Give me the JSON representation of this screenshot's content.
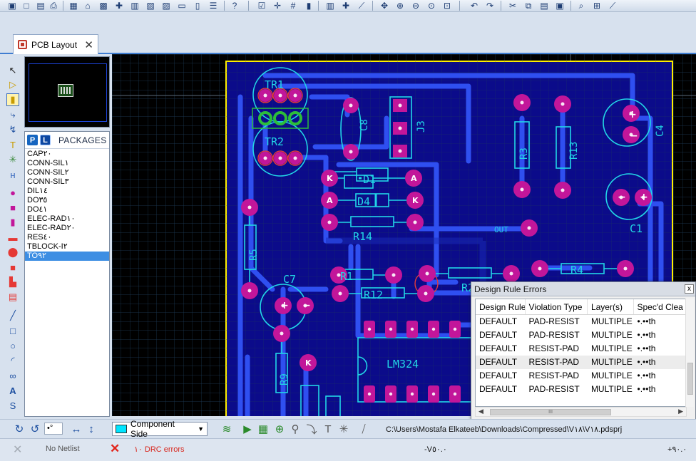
{
  "toolbar": {
    "icons": [
      "select-icon",
      "save-icon",
      "print-icon",
      "home-icon",
      "zoom-icon",
      "help-icon",
      "grid-icon",
      "component-icon",
      "junction-icon",
      "zoom-in-icon",
      "zoom-out-icon",
      "zoom-fit-icon",
      "undo-icon",
      "redo-icon",
      "search-icon"
    ]
  },
  "tab": {
    "label": "PCB Layout",
    "close": "✕"
  },
  "packages": {
    "p_label": "P",
    "l_label": "L",
    "title": "PACKAGES",
    "items": [
      "CAP٢٠",
      "CONN-SIL١",
      "CONN-SIL٢",
      "CONN-SIL٣",
      "DIL١٤",
      "DO٣٥",
      "DO٤١",
      "ELEC-RAD١٠",
      "ELEC-RAD٢٠",
      "RES٤٠",
      "TBLOCK-I٢",
      "TO٩٢"
    ],
    "selected": "TO٩٢"
  },
  "pcb": {
    "labels": [
      "TR1",
      "TR2",
      "C8",
      "J3",
      "R3",
      "R13",
      "C4",
      "D1",
      "D4",
      "R14",
      "C1",
      "OUT",
      "R5",
      "C7",
      "R1",
      "R12",
      "R4",
      "LM324",
      "R9",
      "K",
      "A",
      "K",
      "A",
      "K",
      "R2"
    ]
  },
  "drc_dialog": {
    "title": "Design Rule Errors",
    "close": "x",
    "columns": [
      "Design Rule",
      "Violation Type",
      "Layer(s)",
      "Spec'd Clea"
    ],
    "rows": [
      [
        "DEFAULT",
        "PAD-RESIST",
        "MULTIPLE",
        "•.••th"
      ],
      [
        "DEFAULT",
        "PAD-RESIST",
        "MULTIPLE",
        "•.••th"
      ],
      [
        "DEFAULT",
        "RESIST-PAD",
        "MULTIPLE",
        "•.••th"
      ],
      [
        "DEFAULT",
        "RESIST-PAD",
        "MULTIPLE",
        "•.••th"
      ],
      [
        "DEFAULT",
        "RESIST-PAD",
        "MULTIPLE",
        "•.••th"
      ],
      [
        "DEFAULT",
        "PAD-RESIST",
        "MULTIPLE",
        "•.••th"
      ]
    ],
    "highlighted_row": 3,
    "scroll_thumb": "III"
  },
  "bottom": {
    "zoom_value": "•°",
    "layer": "Component Side",
    "layer_color": "#00e5ff",
    "file_path": "C:\\Users\\Mostafa Elkateeb\\Downloads\\Compressed\\V١٨\\V١٨.pdsprj"
  },
  "status": {
    "no_netlist": "No Netlist",
    "drc_errors": "١٠ DRC errors",
    "coord_x": "-V٥٠.٠",
    "coord_y": "+٩٠.٠"
  },
  "colors": {
    "board_outline": "#ffee00",
    "track": "#1a3bd6",
    "pad": "#c2169a",
    "silkscreen": "#22d6e6",
    "grid": "#1e3d5a",
    "background": "#000000"
  }
}
